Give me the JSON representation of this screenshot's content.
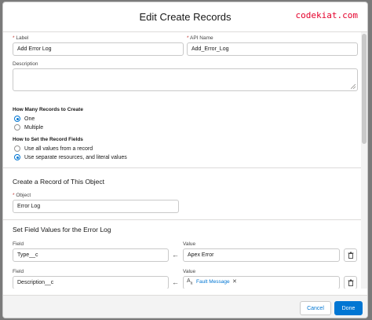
{
  "modal": {
    "title": "Edit Create Records",
    "brand": "codekiat.com"
  },
  "fields": {
    "label": {
      "label": "Label",
      "value": "Add Error Log"
    },
    "api_name": {
      "label": "API Name",
      "value": "Add_Error_Log"
    },
    "description": {
      "label": "Description",
      "value": ""
    }
  },
  "how_many": {
    "title": "How Many Records to Create",
    "options": [
      {
        "label": "One",
        "selected": true
      },
      {
        "label": "Multiple",
        "selected": false
      }
    ]
  },
  "how_to_set": {
    "title": "How to Set the Record Fields",
    "options": [
      {
        "label": "Use all values from a record",
        "selected": false
      },
      {
        "label": "Use separate resources, and literal values",
        "selected": true
      }
    ]
  },
  "create_section": {
    "title": "Create a Record of This Object",
    "object_label": "Object",
    "object_value": "Error Log"
  },
  "field_values": {
    "title": "Set Field Values for the Error Log",
    "rows": [
      {
        "field_label": "Field",
        "field_value": "Type__c",
        "value_label": "Value",
        "value": "Apex Error"
      },
      {
        "field_label": "Field",
        "field_value": "Description__c",
        "value_label": "Value",
        "value": "Fault Message"
      }
    ]
  },
  "footer": {
    "cancel": "Cancel",
    "done": "Done"
  },
  "colors": {
    "accent": "#0176d3",
    "required": "#c23934",
    "brand": "#e4002b"
  },
  "icons": [
    "arrow-left-icon",
    "trash-icon",
    "text-resource-icon",
    "close-icon",
    "resize-grip-icon"
  ]
}
